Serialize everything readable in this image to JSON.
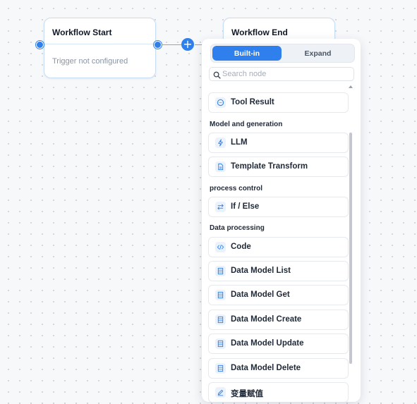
{
  "canvas": {
    "start_node": {
      "title": "Workflow Start",
      "subtitle": "Trigger not configured"
    },
    "end_node": {
      "title": "Workflow End"
    },
    "add_button": {
      "label": "+"
    }
  },
  "panel": {
    "tabs": [
      {
        "label": "Built-in",
        "active": true
      },
      {
        "label": "Expand",
        "active": false
      }
    ],
    "search": {
      "placeholder": "Search node",
      "value": ""
    },
    "groups": {
      "model": "Model and generation",
      "process": "process control",
      "data": "Data processing"
    },
    "items": {
      "tool_result": {
        "label": "Tool Result",
        "icon": "chat-bubble-icon"
      },
      "llm": {
        "label": "LLM",
        "icon": "lightning-icon"
      },
      "template_transform": {
        "label": "Template Transform",
        "icon": "document-icon"
      },
      "if_else": {
        "label": "If / Else",
        "icon": "swap-arrows-icon"
      },
      "code": {
        "label": "Code",
        "icon": "code-icon"
      },
      "data_model_list": {
        "label": "Data Model List",
        "icon": "table-icon"
      },
      "data_model_get": {
        "label": "Data Model Get",
        "icon": "table-icon"
      },
      "data_model_create": {
        "label": "Data Model Create",
        "icon": "table-icon"
      },
      "data_model_update": {
        "label": "Data Model Update",
        "icon": "table-icon"
      },
      "data_model_delete": {
        "label": "Data Model Delete",
        "icon": "table-icon"
      },
      "variable_assign": {
        "label": "变量赋值",
        "icon": "pencil-icon"
      }
    }
  },
  "colors": {
    "accent": "#2f80ed",
    "node_border": "#c7dcf5",
    "icon_bg": "#eaf2fd"
  }
}
